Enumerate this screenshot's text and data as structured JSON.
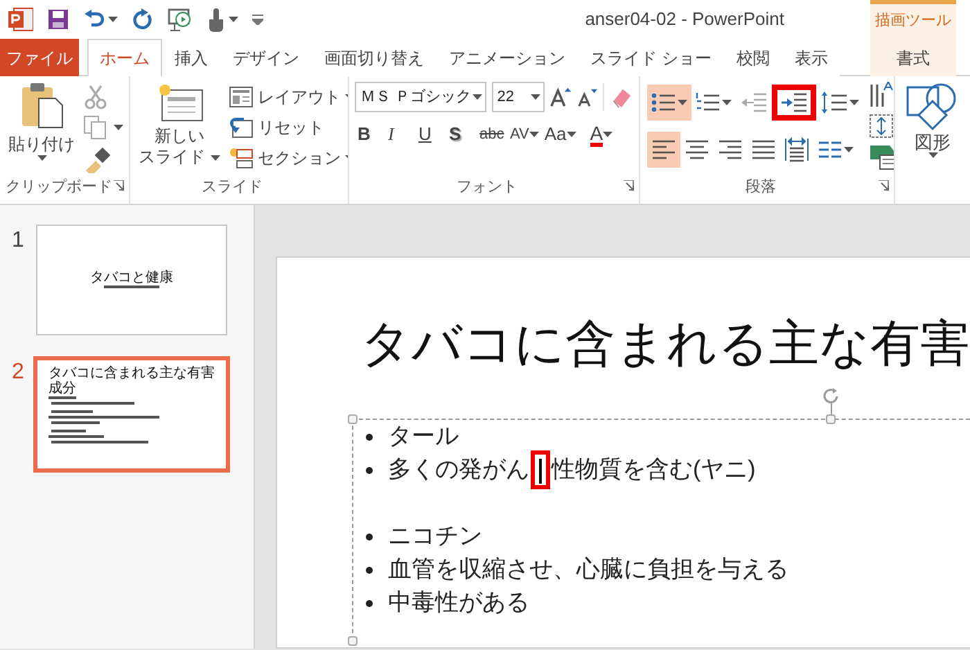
{
  "window": {
    "title": "anser04-02 - PowerPoint"
  },
  "contextual_group": {
    "label": "描画ツール"
  },
  "tabs": [
    {
      "label": "ファイル",
      "kind": "file",
      "selected": false
    },
    {
      "label": "ホーム",
      "kind": "normal",
      "selected": true
    },
    {
      "label": "挿入",
      "kind": "normal",
      "selected": false
    },
    {
      "label": "デザイン",
      "kind": "normal",
      "selected": false
    },
    {
      "label": "画面切り替え",
      "kind": "normal",
      "selected": false
    },
    {
      "label": "アニメーション",
      "kind": "normal",
      "selected": false
    },
    {
      "label": "スライド ショー",
      "kind": "normal",
      "selected": false
    },
    {
      "label": "校閲",
      "kind": "normal",
      "selected": false
    },
    {
      "label": "表示",
      "kind": "normal",
      "selected": false
    },
    {
      "label": "書式",
      "kind": "contextual",
      "selected": false
    }
  ],
  "ribbon": {
    "clipboard": {
      "label": "クリップボード",
      "paste": "貼り付け"
    },
    "slides": {
      "label": "スライド",
      "new_slide": [
        "新しい",
        "スライド"
      ],
      "commands": [
        {
          "kind": "layout",
          "label": "レイアウト",
          "dropdown": true
        },
        {
          "kind": "reset",
          "label": "リセット",
          "dropdown": false
        },
        {
          "kind": "section",
          "label": "セクション",
          "dropdown": true
        }
      ]
    },
    "font": {
      "label": "フォント",
      "font_name": "ＭＳ Ｐゴシック",
      "font_size": "22",
      "styles": [
        {
          "kind": "bold",
          "label": "B"
        },
        {
          "kind": "italic",
          "label": "I"
        },
        {
          "kind": "underline",
          "label": "U"
        },
        {
          "kind": "shadow",
          "label": "S"
        },
        {
          "kind": "strike",
          "label": "abc"
        },
        {
          "kind": "spacing",
          "label": "AV"
        },
        {
          "kind": "case",
          "label": "Aa"
        },
        {
          "kind": "color",
          "label": "A"
        }
      ]
    },
    "paragraph": {
      "label": "段落",
      "row_1": [
        {
          "kind": "bullets",
          "selected": true,
          "highlighted": false
        },
        {
          "kind": "numbering",
          "selected": false,
          "highlighted": false
        },
        {
          "kind": "outdent",
          "selected": false,
          "highlighted": false
        },
        {
          "kind": "indent",
          "selected": false,
          "highlighted": true
        },
        {
          "kind": "line_spacing",
          "selected": false,
          "highlighted": false
        }
      ],
      "row_2": [
        {
          "kind": "align_left",
          "selected": true,
          "highlighted": false
        },
        {
          "kind": "align_center",
          "selected": false,
          "highlighted": false
        },
        {
          "kind": "align_right",
          "selected": false,
          "highlighted": false
        },
        {
          "kind": "justify",
          "selected": false,
          "highlighted": false
        },
        {
          "kind": "distribute",
          "selected": false,
          "highlighted": false
        },
        {
          "kind": "columns",
          "selected": false,
          "highlighted": false
        }
      ]
    },
    "drawing": {
      "shapes": "図形"
    }
  },
  "slides_pane": [
    {
      "number": "1",
      "title": "タバコと健康",
      "selected": false
    },
    {
      "number": "2",
      "title": "タバコに含まれる主な有害成分",
      "selected": true
    }
  ],
  "slide": {
    "title": "タバコに含まれる主な有害",
    "paragraphs": [
      {
        "kind": "bullet",
        "text": "タール"
      },
      {
        "kind": "bullet_caret",
        "before": "多くの発がん",
        "after": "性物質を含む(ヤニ)",
        "caret_highlighted": true
      },
      {
        "kind": "blank"
      },
      {
        "kind": "bullet",
        "text": "ニコチン"
      },
      {
        "kind": "bullet",
        "text": "血管を収縮させ、心臓に負担を与える"
      },
      {
        "kind": "bullet",
        "text": "中毒性がある"
      }
    ]
  }
}
